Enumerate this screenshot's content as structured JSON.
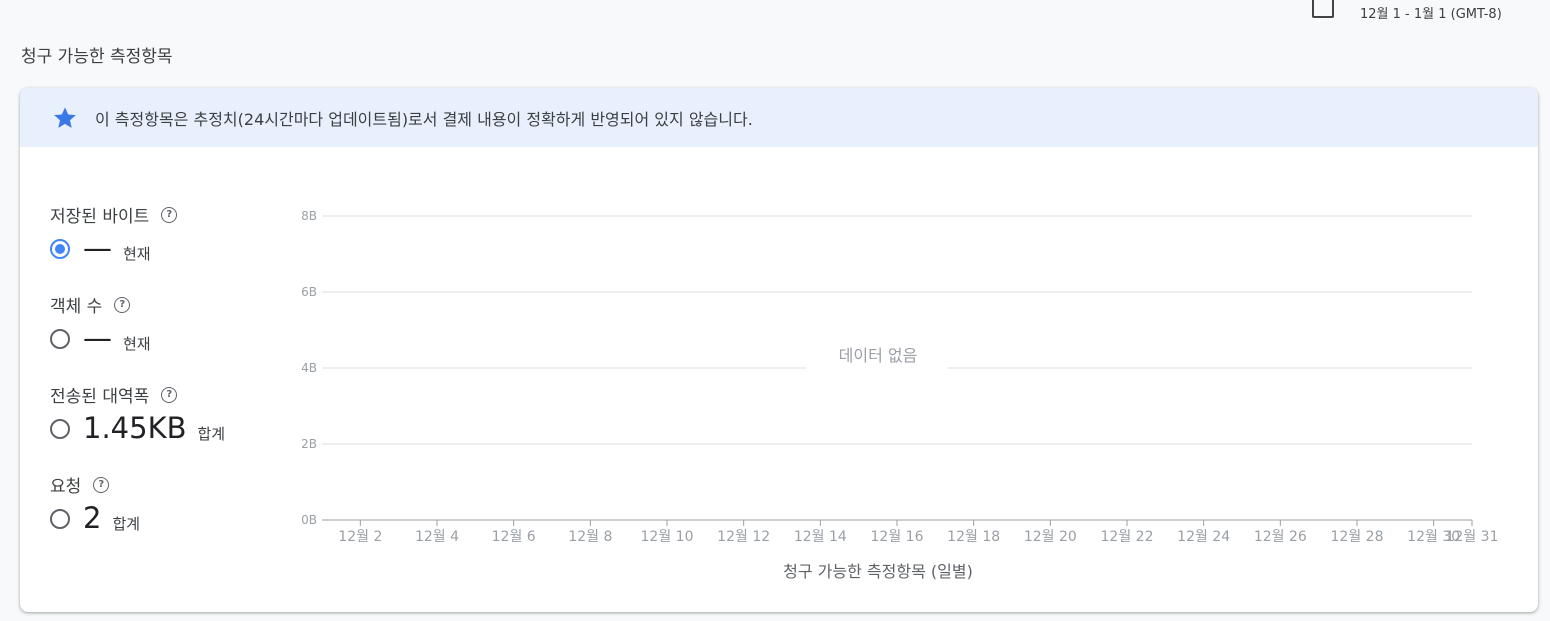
{
  "header": {
    "date_range": "12월 1 - 1월 1 (GMT-8)"
  },
  "section_title": "청구 가능한 측정항목",
  "banner": {
    "text": "이 측정항목은 추정치(24시간마다 업데이트됨)로서 결제 내용이 정확하게 반영되어 있지 않습니다.",
    "icon": "star-icon",
    "accent": "#4285f4",
    "background": "#e8f0fe"
  },
  "metrics": [
    {
      "name": "저장된 바이트",
      "value": "—",
      "unit": "현재",
      "selected": true
    },
    {
      "name": "객체 수",
      "value": "—",
      "unit": "현재",
      "selected": false
    },
    {
      "name": "전송된 대역폭",
      "value": "1.45KB",
      "unit": "합계",
      "selected": false
    },
    {
      "name": "요청",
      "value": "2",
      "unit": "합계",
      "selected": false
    }
  ],
  "help_glyph": "?",
  "chart_data": {
    "type": "line",
    "title": "",
    "xlabel": "청구 가능한 측정항목 (일별)",
    "ylabel": "",
    "no_data_text": "데이터 없음",
    "yticks": [
      "0B",
      "2B",
      "4B",
      "6B",
      "8B"
    ],
    "ylim": [
      0,
      8
    ],
    "xticks": [
      "12월 2",
      "12월 4",
      "12월 6",
      "12월 8",
      "12월 10",
      "12월 12",
      "12월 14",
      "12월 16",
      "12월 18",
      "12월 20",
      "12월 22",
      "12월 24",
      "12월 26",
      "12월 28",
      "12월 30",
      "12월 31"
    ],
    "xlim": [
      1,
      31
    ],
    "grid": true,
    "series": []
  }
}
